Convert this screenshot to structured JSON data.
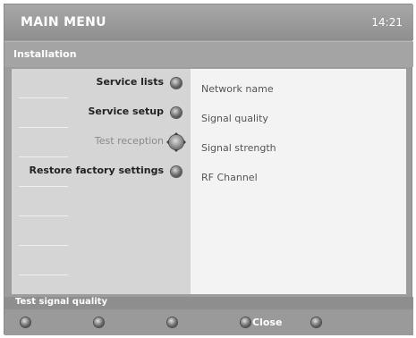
{
  "header": {
    "title": "MAIN MENU",
    "clock": "14:21"
  },
  "section": {
    "title": "Installation"
  },
  "menu": {
    "items": [
      {
        "label": "Service lists",
        "icon": "remote-button-icon"
      },
      {
        "label": "Service setup",
        "icon": "remote-button-icon"
      },
      {
        "label": "Test reception",
        "icon": "navigation-pad-icon",
        "selected": true
      },
      {
        "label": "Restore factory settings",
        "icon": "remote-button-icon"
      }
    ]
  },
  "details": {
    "items": [
      "Network name",
      "Signal quality",
      "Signal strength",
      "RF Channel"
    ]
  },
  "status": {
    "text": "Test signal quality"
  },
  "footer": {
    "buttons": [
      {
        "label": "",
        "icon": "color-key-icon"
      },
      {
        "label": "",
        "icon": "color-key-icon"
      },
      {
        "label": "",
        "icon": "color-key-icon"
      },
      {
        "label": "Close",
        "icon": "color-key-icon"
      },
      {
        "label": "",
        "icon": "color-key-icon"
      }
    ]
  }
}
